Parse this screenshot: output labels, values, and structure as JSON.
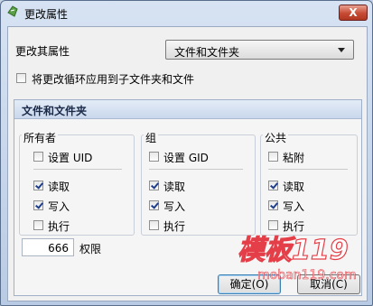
{
  "window": {
    "title": "更改属性",
    "close_symbol": "X"
  },
  "change_attr": {
    "label": "更改其属性",
    "selected": "文件和文件夹"
  },
  "recursive_checkbox": {
    "label": "将更改循环应用到子文件夹和文件",
    "checked": false
  },
  "section": {
    "title": "文件和文件夹"
  },
  "groups": {
    "owner": {
      "title": "所有者",
      "special": "设置 UID",
      "read": "读取",
      "write": "写入",
      "execute": "执行"
    },
    "group": {
      "title": "组",
      "special": "设置 GID",
      "read": "读取",
      "write": "写入",
      "execute": "执行"
    },
    "public": {
      "title": "公共",
      "special": "粘附",
      "read": "读取",
      "write": "写入",
      "execute": "执行"
    }
  },
  "permissions": {
    "value": "666",
    "label": "权限"
  },
  "buttons": {
    "ok": "确定(O)",
    "cancel": "取消(C)"
  },
  "watermark": {
    "brand": "模板119",
    "url": "moban119.com"
  },
  "colors": {
    "title_bg": "#c7d4e6",
    "close_red": "#c74a33",
    "checkbox_check": "#1e3e8c",
    "watermark_red": "#e2202a"
  }
}
